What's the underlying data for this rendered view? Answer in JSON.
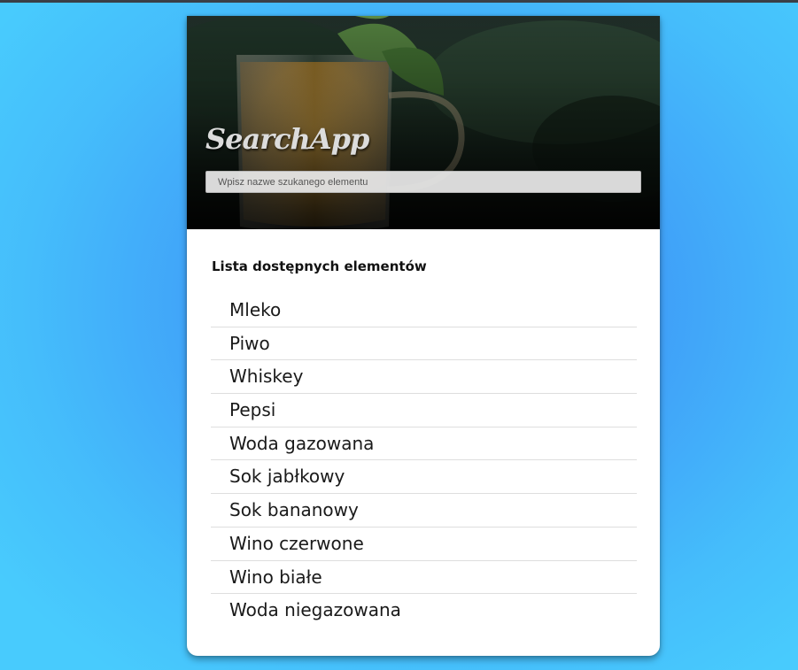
{
  "app": {
    "logo": "SearchApp"
  },
  "search": {
    "placeholder": "Wpisz nazwe szukanego elementu",
    "value": ""
  },
  "list": {
    "title": "Lista dostępnych elementów",
    "items": [
      "Mleko",
      "Piwo",
      "Whiskey",
      "Pepsi",
      "Woda gazowana",
      "Sok jabłkowy",
      "Sok bananowy",
      "Wino czerwone",
      "Wino białe",
      "Woda niegazowana"
    ]
  },
  "colors": {
    "background": "#3f9cf8",
    "card": "#ffffff",
    "divider": "#dedede"
  }
}
